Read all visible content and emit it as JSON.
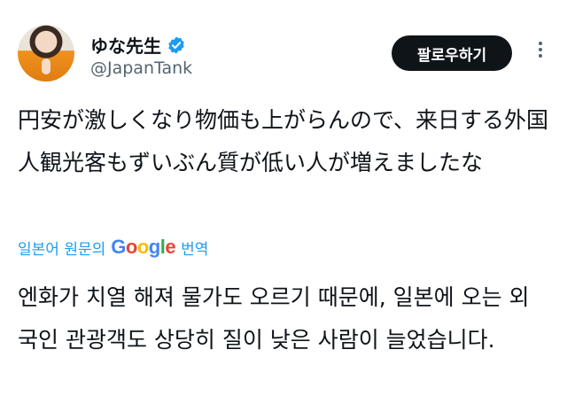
{
  "user": {
    "display_name": "ゆな先生",
    "handle": "@JapanTank",
    "verified_color": "#1d9bf0"
  },
  "actions": {
    "follow_label": "팔로우하기",
    "more_icon": "more-dots-icon"
  },
  "tweet": {
    "text": "円安が激しくなり物価も上がらんので、来日する外国人観光客もずいぶん質が低い人が増えましたな"
  },
  "translation": {
    "prefix": "일본어 원문의",
    "provider_letters": [
      "G",
      "o",
      "o",
      "g",
      "l",
      "e"
    ],
    "provider_colors": [
      "#4285F4",
      "#EA4335",
      "#FBBC05",
      "#4285F4",
      "#34A853",
      "#EA4335"
    ],
    "suffix": "번역",
    "text": "엔화가 치열 해져 물가도 오르기 때문에, 일본에 오는 외국인 관광객도 상당히 질이 낮은 사람이 늘었습니다."
  }
}
